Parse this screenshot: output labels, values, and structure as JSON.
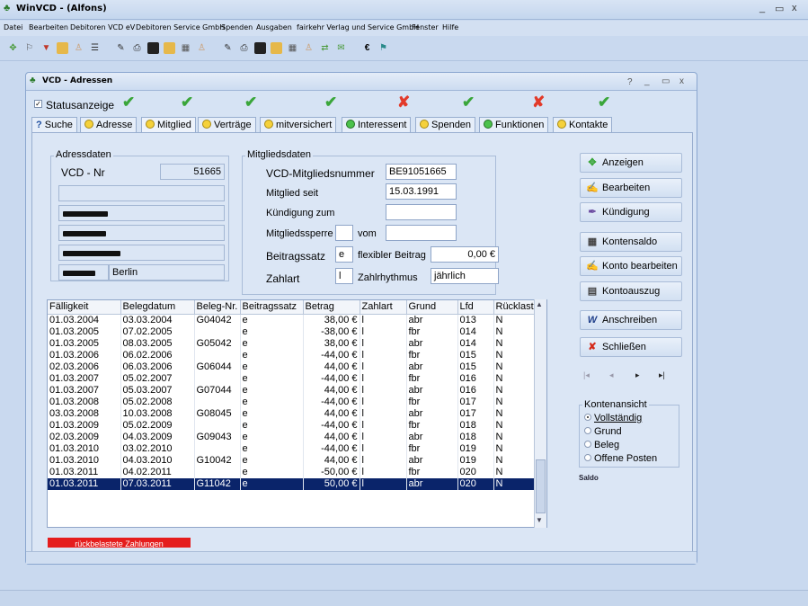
{
  "app": {
    "title": "WinVCD - (Alfons)",
    "controls": [
      "_",
      "▭",
      "x"
    ]
  },
  "menu": [
    "Datei",
    "Bearbeiten",
    "Debitoren VCD eV",
    "Debitoren Service GmbH",
    "Spenden",
    "Ausgaben",
    "fairkehr Verlag und Service GmbH",
    "Fenster",
    "Hilfe"
  ],
  "window": {
    "title": "VCD - Adressen",
    "controls": [
      "?",
      "_",
      "▭",
      "x"
    ]
  },
  "status": {
    "label": "Statusanzeige",
    "checked": true,
    "marks": [
      "check",
      "check",
      "check",
      "check",
      "cross",
      "check",
      "cross",
      "check"
    ]
  },
  "tabs": [
    {
      "label": "Suche",
      "icon": "question"
    },
    {
      "label": "Adresse",
      "icon": "smiley"
    },
    {
      "label": "Mitglied",
      "icon": "smiley"
    },
    {
      "label": "Verträge",
      "icon": "smiley"
    },
    {
      "label": "mitversichert",
      "icon": "smiley"
    },
    {
      "label": "Interessent",
      "icon": "green-smiley"
    },
    {
      "label": "Spenden",
      "icon": "smiley"
    },
    {
      "label": "Funktionen",
      "icon": "green-smiley"
    },
    {
      "label": "Kontakte",
      "icon": "smiley"
    }
  ],
  "adressdaten": {
    "title": "Adressdaten",
    "vcd_nr_label": "VCD - Nr",
    "vcd_nr": "51665",
    "city": "Berlin"
  },
  "mitgliedsdaten": {
    "title": "Mitgliedsdaten",
    "nummer_label": "VCD-Mitgliedsnummer",
    "nummer": "BE91051665",
    "seit_label": "Mitglied seit",
    "seit": "15.03.1991",
    "kuendigung_label": "Kündigung zum",
    "kuendigung": "",
    "sperre_label": "Mitgliedssperre",
    "sperre": "",
    "vom_label": "vom",
    "vom": "",
    "beitragssatz_label": "Beitragssatz",
    "beitragssatz": "e",
    "flex_label": "flexibler Beitrag",
    "flex": "0,00 €",
    "zahlart_label": "Zahlart",
    "zahlart": "l",
    "rhythmus_label": "Zahlrhythmus",
    "rhythmus": "jährlich"
  },
  "table": {
    "columns": [
      "Fälligkeit",
      "Belegdatum",
      "Beleg-Nr.",
      "Beitragssatz",
      "Betrag",
      "Zahlart",
      "Grund",
      "Lfd",
      "Rücklast"
    ],
    "rows": [
      [
        "01.03.2004",
        "03.03.2004",
        "G04042",
        "e",
        "38,00 €",
        "l",
        "abr",
        "013",
        "N"
      ],
      [
        "01.03.2005",
        "07.02.2005",
        "",
        "e",
        "-38,00 €",
        "l",
        "fbr",
        "014",
        "N"
      ],
      [
        "01.03.2005",
        "08.03.2005",
        "G05042",
        "e",
        "38,00 €",
        "l",
        "abr",
        "014",
        "N"
      ],
      [
        "01.03.2006",
        "06.02.2006",
        "",
        "e",
        "-44,00 €",
        "l",
        "fbr",
        "015",
        "N"
      ],
      [
        "02.03.2006",
        "06.03.2006",
        "G06044",
        "e",
        "44,00 €",
        "l",
        "abr",
        "015",
        "N"
      ],
      [
        "01.03.2007",
        "05.02.2007",
        "",
        "e",
        "-44,00 €",
        "l",
        "fbr",
        "016",
        "N"
      ],
      [
        "01.03.2007",
        "05.03.2007",
        "G07044",
        "e",
        "44,00 €",
        "l",
        "abr",
        "016",
        "N"
      ],
      [
        "01.03.2008",
        "05.02.2008",
        "",
        "e",
        "-44,00 €",
        "l",
        "fbr",
        "017",
        "N"
      ],
      [
        "03.03.2008",
        "10.03.2008",
        "G08045",
        "e",
        "44,00 €",
        "l",
        "abr",
        "017",
        "N"
      ],
      [
        "01.03.2009",
        "05.02.2009",
        "",
        "e",
        "-44,00 €",
        "l",
        "fbr",
        "018",
        "N"
      ],
      [
        "02.03.2009",
        "04.03.2009",
        "G09043",
        "e",
        "44,00 €",
        "l",
        "abr",
        "018",
        "N"
      ],
      [
        "01.03.2010",
        "03.02.2010",
        "",
        "e",
        "-44,00 €",
        "l",
        "fbr",
        "019",
        "N"
      ],
      [
        "01.03.2010",
        "04.03.2010",
        "G10042",
        "e",
        "44,00 €",
        "l",
        "abr",
        "019",
        "N"
      ],
      [
        "01.03.2011",
        "04.02.2011",
        "",
        "e",
        "-50,00 €",
        "l",
        "fbr",
        "020",
        "N"
      ],
      [
        "01.03.2011",
        "07.03.2011",
        "G11042",
        "e",
        "50,00 €",
        "l",
        "abr",
        "020",
        "N"
      ]
    ],
    "selected_index": 14
  },
  "buttons": {
    "anzeigen": "Anzeigen",
    "bearbeiten": "Bearbeiten",
    "kuendigung": "Kündigung",
    "kontensaldo": "Kontensaldo",
    "konto_bearbeiten": "Konto bearbeiten",
    "kontoauszug": "Kontoauszug",
    "anschreiben": "Anschreiben",
    "schliessen": "Schließen"
  },
  "nav": [
    "|◂",
    "◂",
    "▸",
    "▸|"
  ],
  "kontenansicht": {
    "title": "Kontenansicht",
    "options": [
      "Vollständig",
      "Grund",
      "Beleg",
      "Offene Posten"
    ],
    "selected": 0
  },
  "saldo_label": "Saldo",
  "red_bar": "rückbelastete Zahlungen",
  "colors": {
    "selected_row": "#0a246a",
    "red_bar": "#e51d1d",
    "check": "#3aa63a",
    "cross": "#e23a2a"
  }
}
